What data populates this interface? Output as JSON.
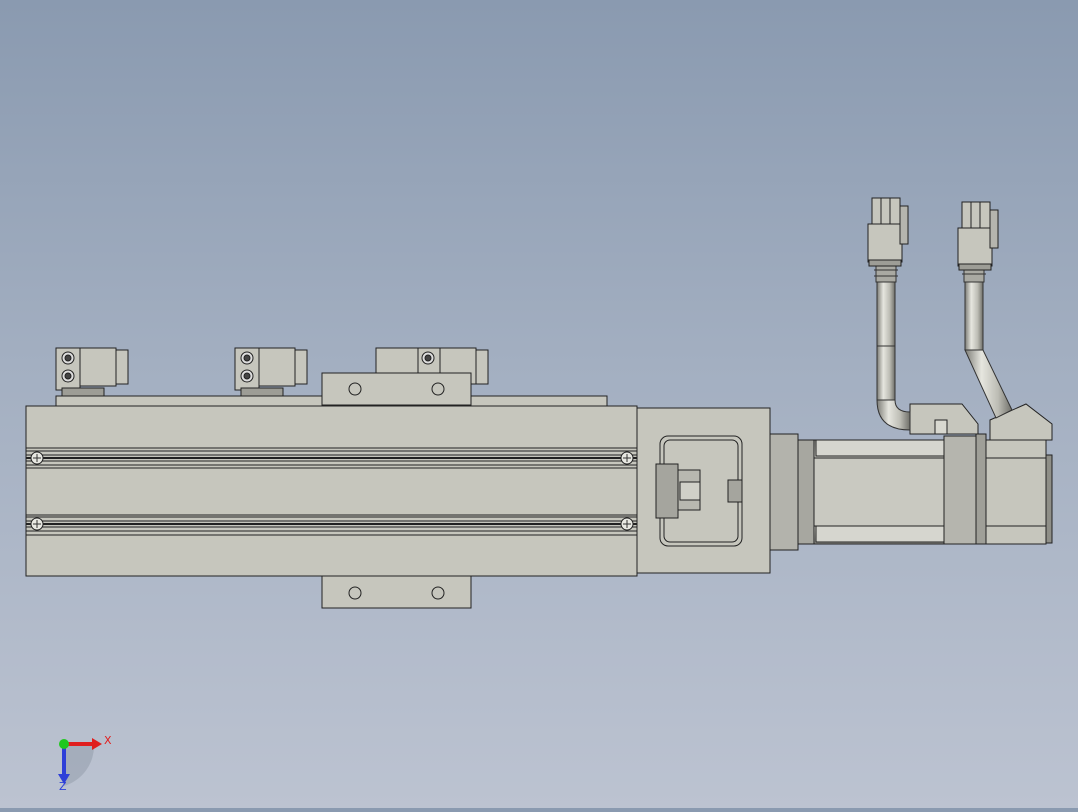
{
  "viewport": {
    "background_top": "#8a9ab0",
    "background_bottom": "#bcc3d1"
  },
  "model": {
    "part_fill": "#c6c6bd",
    "part_dark": "#8f8f88",
    "edge_color": "#222222"
  },
  "triad": {
    "x_label": "X",
    "z_label": "Z",
    "x_color": "#e01e1e",
    "y_color": "#1ec81e",
    "z_color": "#2e3fd8"
  }
}
